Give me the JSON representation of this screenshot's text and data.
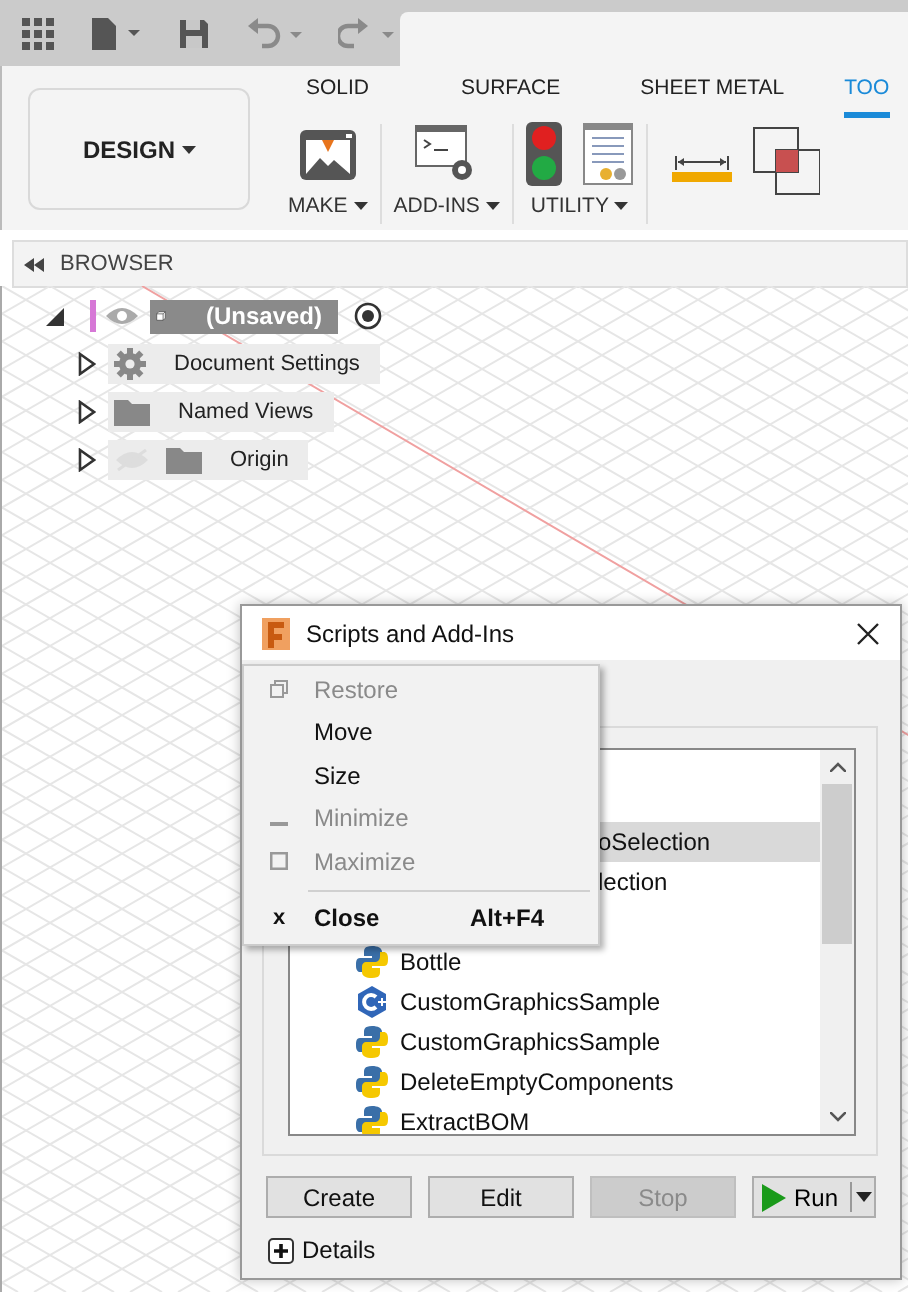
{
  "ribbon": {
    "workspace": "DESIGN",
    "tabs": [
      {
        "label": "SOLID",
        "selected": false
      },
      {
        "label": "SURFACE",
        "selected": false
      },
      {
        "label": "SHEET METAL",
        "selected": false
      },
      {
        "label": "TOO",
        "selected": true
      }
    ],
    "groups": [
      {
        "label": "MAKE",
        "kind": "printer"
      },
      {
        "label": "ADD-INS",
        "kind": "script"
      },
      {
        "label": "UTILITY",
        "kind": "utility"
      }
    ]
  },
  "browser": {
    "title": "BROWSER",
    "root": {
      "label": "(Unsaved)",
      "expanded": true,
      "children": [
        {
          "label": "Document Settings",
          "kind": "settings",
          "hidden": false,
          "expanded": false
        },
        {
          "label": "Named Views",
          "kind": "folder",
          "hidden": false,
          "expanded": false
        },
        {
          "label": "Origin",
          "kind": "folder",
          "hidden": true,
          "expanded": false
        }
      ]
    }
  },
  "dialog": {
    "title": "Scripts and Add-Ins",
    "list": [
      {
        "label": "oSelection",
        "kind": "clipped",
        "selected": true
      },
      {
        "label": "lection",
        "kind": "clipped",
        "selected": false
      },
      {
        "label": "Bottle",
        "kind": "python",
        "selected": false
      },
      {
        "label": "CustomGraphicsSample",
        "kind": "cpp",
        "selected": false
      },
      {
        "label": "CustomGraphicsSample",
        "kind": "python",
        "selected": false
      },
      {
        "label": "DeleteEmptyComponents",
        "kind": "python",
        "selected": false
      },
      {
        "label": "ExtractBOM",
        "kind": "python",
        "selected": false
      }
    ],
    "buttons": [
      {
        "label": "Create",
        "disabled": false
      },
      {
        "label": "Edit",
        "disabled": false
      },
      {
        "label": "Stop",
        "disabled": true
      }
    ],
    "run_button": {
      "label": "Run"
    },
    "details": {
      "label": "Details",
      "expanded": false
    }
  },
  "system_menu": {
    "items": [
      {
        "kind": "restore",
        "label": "Restore",
        "disabled": true,
        "default": false
      },
      {
        "kind": "item",
        "label": "Move",
        "disabled": false,
        "default": false
      },
      {
        "kind": "item",
        "label": "Size",
        "disabled": false,
        "default": false
      },
      {
        "kind": "minimize",
        "label": "Minimize",
        "disabled": true,
        "default": false
      },
      {
        "kind": "maximize",
        "label": "Maximize",
        "disabled": true,
        "default": false
      },
      {
        "kind": "separator"
      },
      {
        "kind": "item",
        "label": "Close",
        "glyph": "x",
        "shortcut": "Alt+F4",
        "disabled": false,
        "default": true
      }
    ]
  }
}
